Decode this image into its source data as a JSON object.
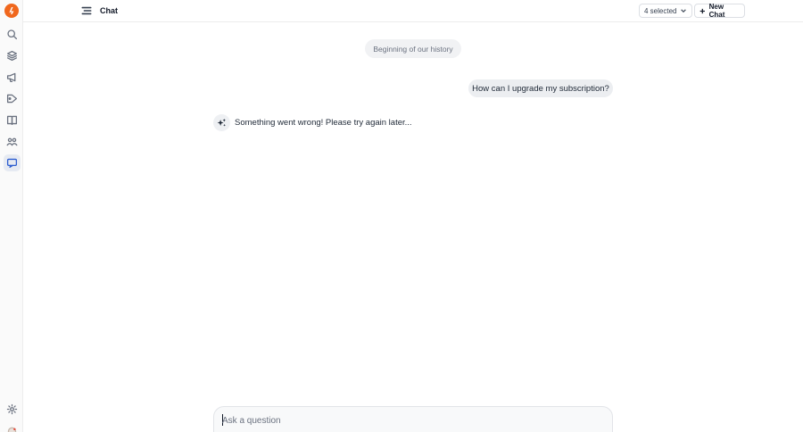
{
  "header": {
    "title": "Chat",
    "selector_label": "4 selected",
    "new_chat_label": "New Chat"
  },
  "sidebar": {
    "items": [
      {
        "icon": "search-icon"
      },
      {
        "icon": "layers-icon"
      },
      {
        "icon": "megaphone-icon"
      },
      {
        "icon": "tag-icon"
      },
      {
        "icon": "book-icon"
      },
      {
        "icon": "users-icon"
      },
      {
        "icon": "chat-monitor-icon",
        "active": true
      }
    ],
    "bottom_items": [
      {
        "icon": "gear-icon"
      },
      {
        "icon": "user-avatar-icon"
      }
    ]
  },
  "chat": {
    "history_label": "Beginning of our history",
    "messages": [
      {
        "role": "user",
        "text": "How can I upgrade my subscription?"
      },
      {
        "role": "assistant",
        "text": "Something went wrong! Please try again later..."
      }
    ],
    "input_placeholder": "Ask a question"
  },
  "colors": {
    "brand": "#f0671d",
    "accent": "#2f5fd0",
    "bubble": "#eceef1"
  }
}
